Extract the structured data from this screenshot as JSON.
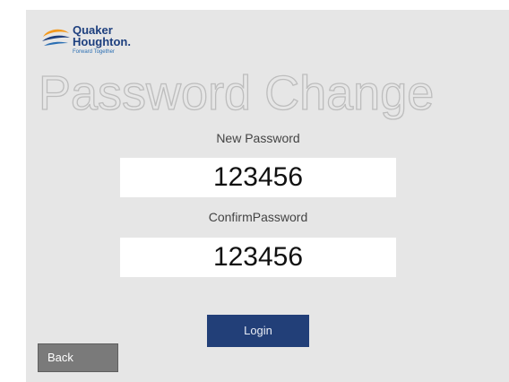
{
  "logo": {
    "line1": "Quaker",
    "line2": "Houghton.",
    "tagline": "Forward Together",
    "icon": "quaker-houghton-logo-icon"
  },
  "page": {
    "title": "Password Change"
  },
  "form": {
    "new_password_label": "New Password",
    "new_password_value": "123456",
    "confirm_password_label": "ConfirmPassword",
    "confirm_password_value": "123456"
  },
  "buttons": {
    "login_label": "Login",
    "back_label": "Back"
  },
  "colors": {
    "background": "#e6e6e6",
    "login_button": "#223f78",
    "back_button": "#7a7a7a",
    "brand_blue": "#1d3f7e",
    "brand_orange": "#f39a1f"
  }
}
